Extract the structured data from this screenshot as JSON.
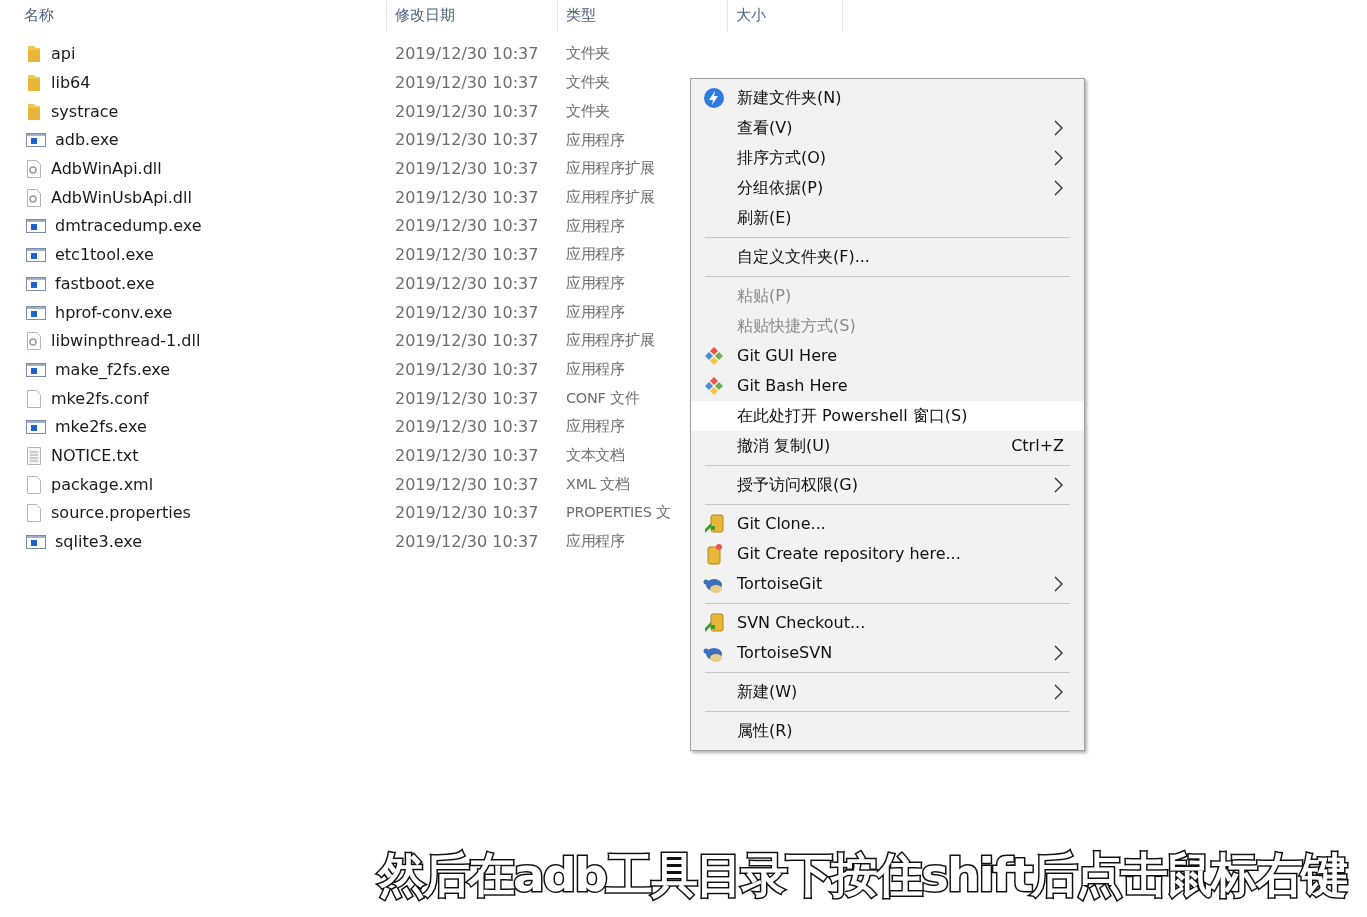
{
  "columns": [
    "名称",
    "修改日期",
    "类型",
    "大小"
  ],
  "files": [
    {
      "name": "api",
      "kind": "folder",
      "date": "2019/12/30 10:37",
      "type": "文件夹"
    },
    {
      "name": "lib64",
      "kind": "folder",
      "date": "2019/12/30 10:37",
      "type": "文件夹"
    },
    {
      "name": "systrace",
      "kind": "folder",
      "date": "2019/12/30 10:37",
      "type": "文件夹"
    },
    {
      "name": "adb.exe",
      "kind": "exe",
      "date": "2019/12/30 10:37",
      "type": "应用程序"
    },
    {
      "name": "AdbWinApi.dll",
      "kind": "dll",
      "date": "2019/12/30 10:37",
      "type": "应用程序扩展"
    },
    {
      "name": "AdbWinUsbApi.dll",
      "kind": "dll",
      "date": "2019/12/30 10:37",
      "type": "应用程序扩展"
    },
    {
      "name": "dmtracedump.exe",
      "kind": "exe",
      "date": "2019/12/30 10:37",
      "type": "应用程序"
    },
    {
      "name": "etc1tool.exe",
      "kind": "exe",
      "date": "2019/12/30 10:37",
      "type": "应用程序"
    },
    {
      "name": "fastboot.exe",
      "kind": "exe",
      "date": "2019/12/30 10:37",
      "type": "应用程序"
    },
    {
      "name": "hprof-conv.exe",
      "kind": "exe",
      "date": "2019/12/30 10:37",
      "type": "应用程序"
    },
    {
      "name": "libwinpthread-1.dll",
      "kind": "dll",
      "date": "2019/12/30 10:37",
      "type": "应用程序扩展"
    },
    {
      "name": "make_f2fs.exe",
      "kind": "exe",
      "date": "2019/12/30 10:37",
      "type": "应用程序"
    },
    {
      "name": "mke2fs.conf",
      "kind": "blank",
      "date": "2019/12/30 10:37",
      "type": "CONF 文件"
    },
    {
      "name": "mke2fs.exe",
      "kind": "exe",
      "date": "2019/12/30 10:37",
      "type": "应用程序"
    },
    {
      "name": "NOTICE.txt",
      "kind": "text",
      "date": "2019/12/30 10:37",
      "type": "文本文档"
    },
    {
      "name": "package.xml",
      "kind": "blank",
      "date": "2019/12/30 10:37",
      "type": "XML 文档"
    },
    {
      "name": "source.properties",
      "kind": "blank",
      "date": "2019/12/30 10:37",
      "type": "PROPERTIES 文"
    },
    {
      "name": "sqlite3.exe",
      "kind": "exe",
      "date": "2019/12/30 10:37",
      "type": "应用程序"
    }
  ],
  "context_menu": [
    {
      "kind": "bolt",
      "label": "新建文件夹(N)",
      "submenu": false,
      "disabled": false,
      "selected": false
    },
    {
      "kind": "item",
      "label": "查看(V)",
      "submenu": true,
      "disabled": false,
      "selected": false
    },
    {
      "kind": "item",
      "label": "排序方式(O)",
      "submenu": true,
      "disabled": false,
      "selected": false
    },
    {
      "kind": "item",
      "label": "分组依据(P)",
      "submenu": true,
      "disabled": false,
      "selected": false
    },
    {
      "kind": "item",
      "label": "刷新(E)",
      "submenu": false,
      "disabled": false,
      "selected": false
    },
    {
      "kind": "separator"
    },
    {
      "kind": "item",
      "label": "自定义文件夹(F)...",
      "submenu": false,
      "disabled": false,
      "selected": false
    },
    {
      "kind": "separator"
    },
    {
      "kind": "item",
      "label": "粘贴(P)",
      "submenu": false,
      "disabled": true,
      "selected": false
    },
    {
      "kind": "item",
      "label": "粘贴快捷方式(S)",
      "submenu": false,
      "disabled": true,
      "selected": false
    },
    {
      "kind": "git",
      "label": "Git GUI Here",
      "submenu": false,
      "disabled": false,
      "selected": false
    },
    {
      "kind": "git",
      "label": "Git Bash Here",
      "submenu": false,
      "disabled": false,
      "selected": false
    },
    {
      "kind": "item",
      "label": "在此处打开 Powershell 窗口(S)",
      "submenu": false,
      "disabled": false,
      "selected": true
    },
    {
      "kind": "item",
      "label": "撤消 复制(U)",
      "shortcut": "Ctrl+Z",
      "submenu": false,
      "disabled": false,
      "selected": false
    },
    {
      "kind": "separator"
    },
    {
      "kind": "item",
      "label": "授予访问权限(G)",
      "submenu": true,
      "disabled": false,
      "selected": false
    },
    {
      "kind": "separator"
    },
    {
      "kind": "clone",
      "label": "Git Clone...",
      "submenu": false,
      "disabled": false,
      "selected": false
    },
    {
      "kind": "repo",
      "label": "Git Create repository here...",
      "submenu": false,
      "disabled": false,
      "selected": false
    },
    {
      "kind": "turtle",
      "label": "TortoiseGit",
      "submenu": true,
      "disabled": false,
      "selected": false
    },
    {
      "kind": "separator"
    },
    {
      "kind": "clone",
      "label": "SVN Checkout...",
      "submenu": false,
      "disabled": false,
      "selected": false
    },
    {
      "kind": "turtle",
      "label": "TortoiseSVN",
      "submenu": true,
      "disabled": false,
      "selected": false
    },
    {
      "kind": "separator"
    },
    {
      "kind": "item",
      "label": "新建(W)",
      "submenu": true,
      "disabled": false,
      "selected": false
    },
    {
      "kind": "separator"
    },
    {
      "kind": "item",
      "label": "属性(R)",
      "submenu": false,
      "disabled": false,
      "selected": false
    }
  ],
  "caption": "然后在adb工具目录下按住shift后点击鼠标右键"
}
